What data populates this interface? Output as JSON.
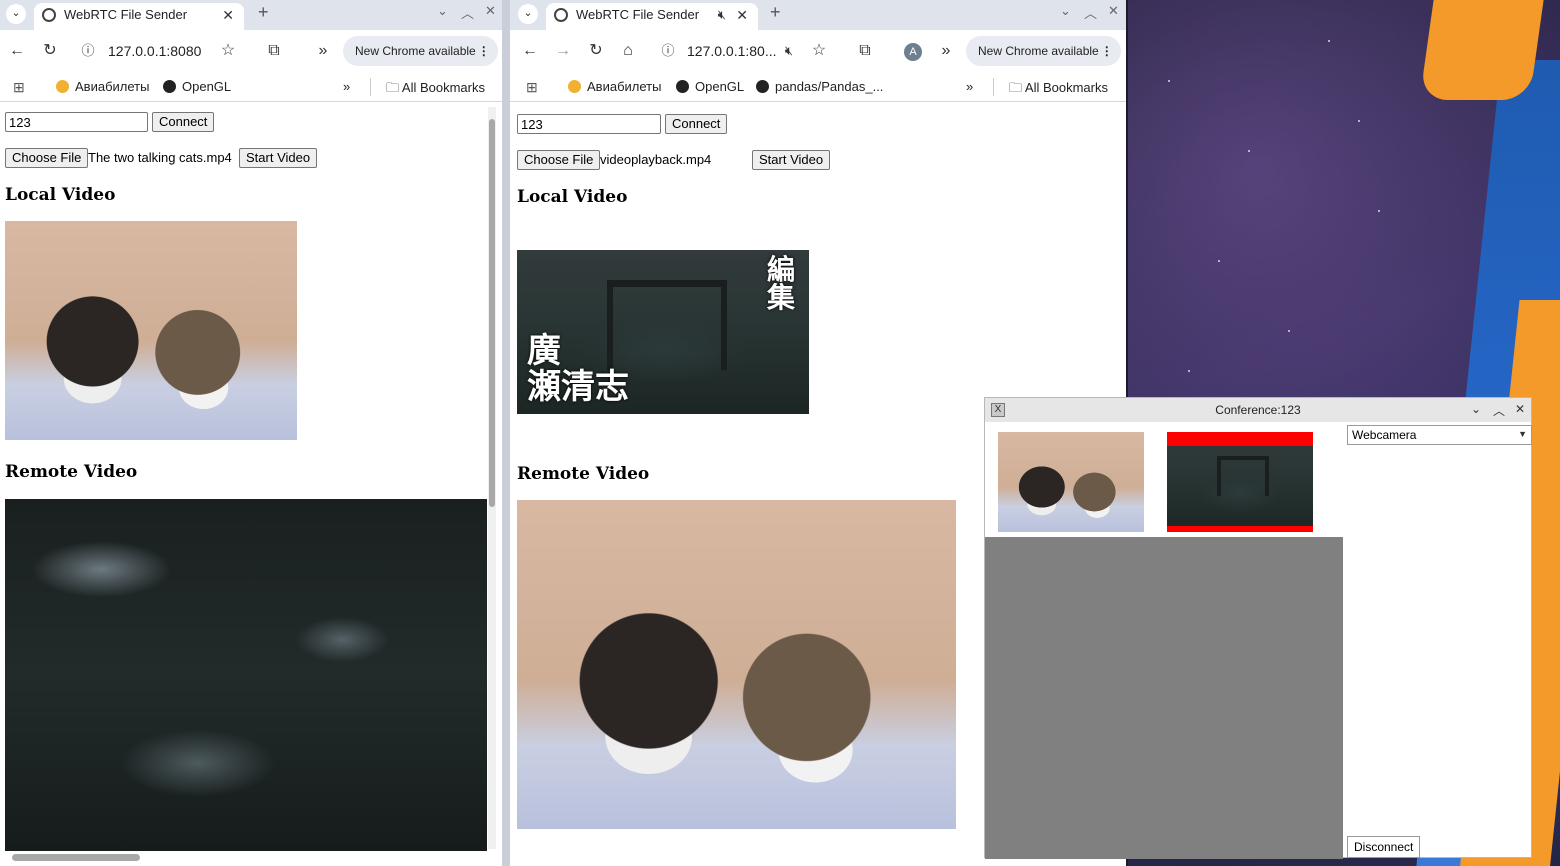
{
  "left_browser": {
    "tab_title": "WebRTC File Sender",
    "url": "127.0.0.1:8080",
    "update_pill": "New Chrome available",
    "bookmarks": [
      "Авиабилеты",
      "OpenGL"
    ],
    "all_bookmarks": "All Bookmarks",
    "room_value": "123",
    "connect_label": "Connect",
    "choose_file_label": "Choose File",
    "file_name": "The two talking cats.mp4",
    "start_video_label": "Start Video",
    "local_video_heading": "Local Video",
    "remote_video_heading": "Remote Video"
  },
  "right_browser": {
    "tab_title": "WebRTC File Sender",
    "url": "127.0.0.1:80...",
    "update_pill": "New Chrome available",
    "avatar_letter": "A",
    "bookmarks": [
      "Авиабилеты",
      "OpenGL",
      "pandas/Pandas_..."
    ],
    "all_bookmarks": "All Bookmarks",
    "room_value": "123",
    "connect_label": "Connect",
    "choose_file_label": "Choose File",
    "file_name": "videoplayback.mp4",
    "start_video_label": "Start Video",
    "local_video_heading": "Local Video",
    "remote_video_heading": "Remote Video",
    "video_overlay_text": {
      "top": "編集",
      "name1": "廣",
      "name2": "瀬清志"
    }
  },
  "conference": {
    "title": "Conference:123",
    "source_select": "Webcamera",
    "disconnect_label": "Disconnect"
  },
  "icons": [
    "chevron-down-icon",
    "globe-icon",
    "close-icon",
    "plus-icon",
    "back-icon",
    "forward-icon",
    "reload-icon",
    "home-icon",
    "info-icon",
    "star-icon",
    "extensions-icon",
    "more-icon",
    "apps-icon",
    "folder-icon",
    "mute-icon",
    "x-logo-icon",
    "minimize-icon",
    "maximize-icon"
  ],
  "colors": {
    "tabstrip": "#dfe3eb",
    "conference_bar": "#ff0000",
    "gray_panel": "#808080"
  }
}
